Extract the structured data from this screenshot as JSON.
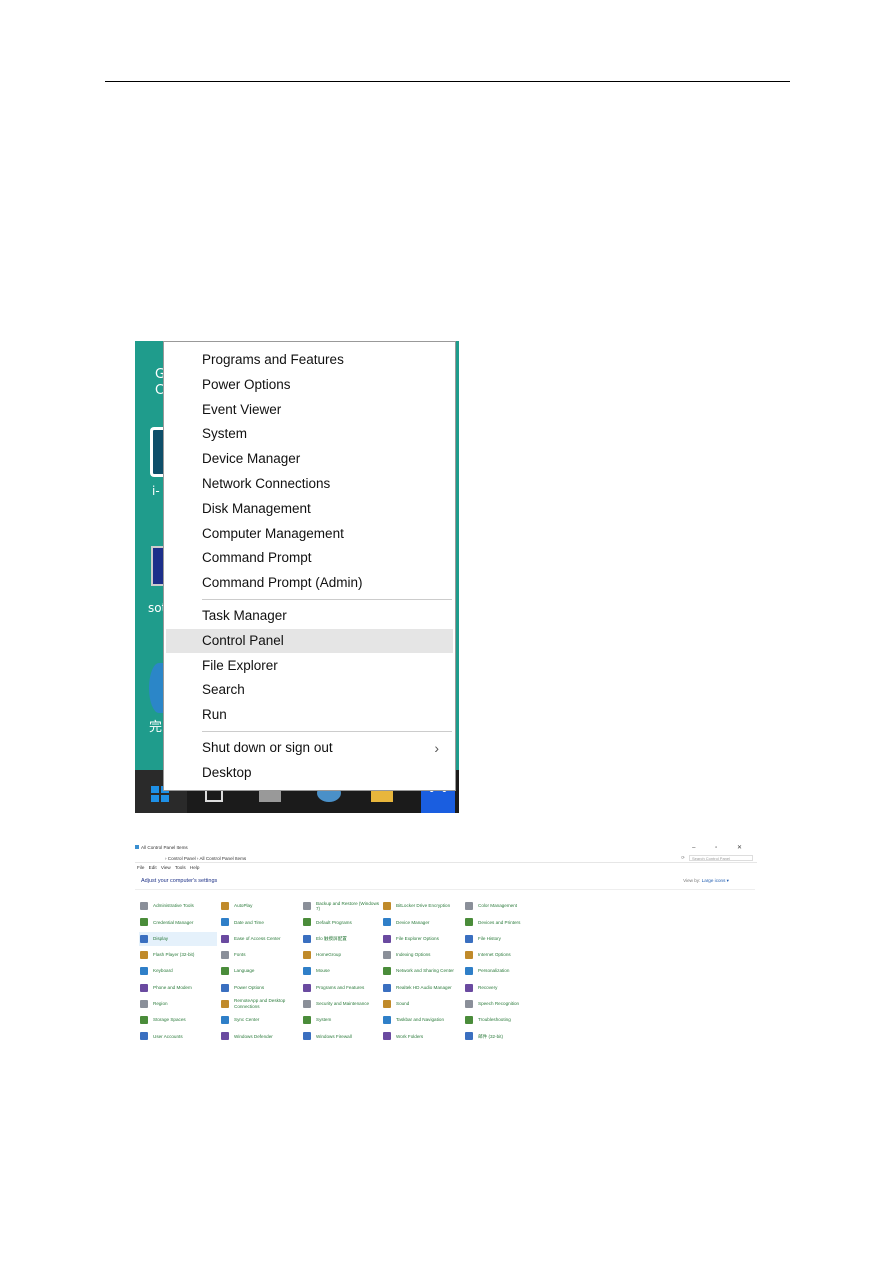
{
  "winx_menu": {
    "groups": [
      [
        "Programs and Features",
        "Power Options",
        "Event Viewer",
        "System",
        "Device Manager",
        "Network Connections",
        "Disk Management",
        "Computer Management",
        "Command Prompt",
        "Command Prompt (Admin)"
      ],
      [
        "Task Manager",
        "Control Panel",
        "File Explorer",
        "Search",
        "Run"
      ],
      [
        "Shut down or sign out",
        "Desktop"
      ]
    ],
    "highlighted": "Control Panel",
    "submenu_arrow": "›",
    "desktop_fragments": {
      "top": "G\nC",
      "icon_label": "i-",
      "pc_label": "sot",
      "cjk_label": "完"
    },
    "colors": {
      "desktop": "#1f9c8c",
      "taskbar": "#1b1b1b",
      "highlight": "#e5e5e5"
    }
  },
  "control_panel": {
    "title": "All Control Panel Items",
    "window_buttons": "– ▫ ✕",
    "breadcrumb": "› Control Panel › All Control Panel Items",
    "search_placeholder": "Search Control Panel",
    "menu": "File Edit View Tools Help",
    "heading": "Adjust your computer's settings",
    "view_by_label": "View by:",
    "view_by_value": "Large icons ▾",
    "selected": "Display",
    "columns": [
      [
        "Administrative Tools",
        "Credential Manager",
        "Display",
        "Flash Player (32-bit)",
        "Keyboard",
        "Phone and Modem",
        "Region",
        "Storage Spaces",
        "User Accounts"
      ],
      [
        "AutoPlay",
        "Date and Time",
        "Ease of Access Center",
        "Fonts",
        "Language",
        "Power Options",
        "RemoteApp and Desktop Connections",
        "Sync Center",
        "Windows Defender"
      ],
      [
        "Backup and Restore (Windows 7)",
        "Default Programs",
        "Elo 触摸屏配置",
        "HomeGroup",
        "Mouse",
        "Programs and Features",
        "Security and Maintenance",
        "System",
        "Windows Firewall"
      ],
      [
        "BitLocker Drive Encryption",
        "Device Manager",
        "File Explorer Options",
        "Indexing Options",
        "Network and Sharing Center",
        "Realtek HD Audio Manager",
        "Sound",
        "Taskbar and Navigation",
        "Work Folders"
      ],
      [
        "Color Management",
        "Devices and Printers",
        "File History",
        "Internet Options",
        "Personalization",
        "Recovery",
        "Speech Recognition",
        "Troubleshooting",
        "邮件 (32-bit)"
      ]
    ],
    "colors": {
      "link": "#2a7a3a",
      "heading": "#1e3287",
      "selected_bg": "#e5f1fb"
    }
  }
}
